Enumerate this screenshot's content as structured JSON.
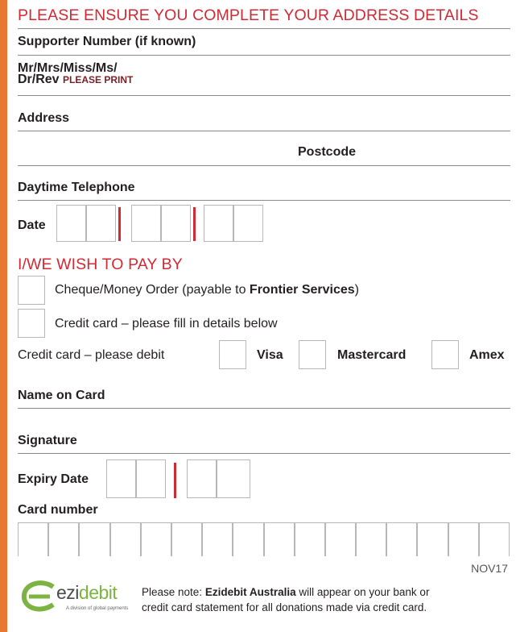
{
  "header": {
    "title": "PLEASE ENSURE YOU COMPLETE YOUR ADDRESS DETAILS"
  },
  "fields": {
    "supporter": "Supporter Number (if known)",
    "title_line1": "Mr/Mrs/Miss/Ms/",
    "title_line2": "Dr/Rev",
    "please_print": "PLEASE PRINT",
    "address": "Address",
    "postcode": "Postcode",
    "telephone": "Daytime Telephone",
    "date": "Date"
  },
  "payment": {
    "heading": "I/WE WISH TO PAY BY",
    "cheque_prefix": "Cheque/Money Order (payable to ",
    "cheque_payee": "Frontier Services",
    "cheque_suffix": ")",
    "credit_option": "Credit card – please fill in details below",
    "debit_label": "Credit card – please debit",
    "visa": "Visa",
    "mastercard": "Mastercard",
    "amex": "Amex"
  },
  "card": {
    "name": "Name on Card",
    "signature": "Signature",
    "expiry": "Expiry Date",
    "number": "Card number"
  },
  "footer": {
    "code": "NOV17",
    "note_prefix": "Please note: ",
    "note_company": "Ezidebit Australia",
    "note_line1_rest": " will appear on your bank or",
    "note_line2": "credit card statement for all donations made via credit card.",
    "logo_ezi": "ezi",
    "logo_debit": "debit",
    "logo_tagline": "A division of global payments"
  },
  "colors": {
    "accent_red": "#d02a34",
    "edge_orange": "#e8782f",
    "logo_green": "#7cb342"
  }
}
